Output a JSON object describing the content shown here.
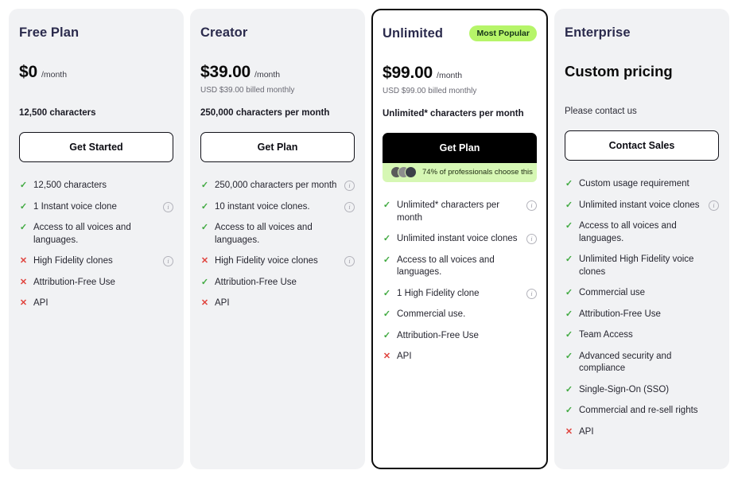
{
  "plans": [
    {
      "name": "Free Plan",
      "badge": null,
      "price": "$0",
      "per": "/month",
      "billed": "",
      "chars": "12,500 characters",
      "chars_bold": true,
      "cta": "Get Started",
      "cta_style": "outline",
      "promo": null,
      "features": [
        {
          "ok": true,
          "text": "12,500 characters",
          "info": false
        },
        {
          "ok": true,
          "text": "1 Instant voice clone",
          "info": true
        },
        {
          "ok": true,
          "text": "Access to all voices and languages.",
          "info": false
        },
        {
          "ok": false,
          "text": "High Fidelity clones",
          "info": true
        },
        {
          "ok": false,
          "text": "Attribution-Free Use",
          "info": false
        },
        {
          "ok": false,
          "text": "API",
          "info": false
        }
      ]
    },
    {
      "name": "Creator",
      "badge": null,
      "price": "$39.00",
      "per": "/month",
      "billed": "USD $39.00 billed monthly",
      "chars": "250,000 characters per month",
      "chars_bold": true,
      "cta": "Get Plan",
      "cta_style": "outline",
      "promo": null,
      "features": [
        {
          "ok": true,
          "text": "250,000 characters per month",
          "info": true
        },
        {
          "ok": true,
          "text": "10 instant voice clones.",
          "info": true
        },
        {
          "ok": true,
          "text": "Access to all voices and languages.",
          "info": false
        },
        {
          "ok": false,
          "text": "High Fidelity voice clones",
          "info": true
        },
        {
          "ok": true,
          "text": "Attribution-Free Use",
          "info": false
        },
        {
          "ok": false,
          "text": "API",
          "info": false
        }
      ]
    },
    {
      "name": "Unlimited",
      "badge": "Most Popular",
      "price": "$99.00",
      "per": "/month",
      "billed": "USD $99.00 billed monthly",
      "chars": "Unlimited* characters per month",
      "chars_bold": true,
      "cta": "Get Plan",
      "cta_style": "dark",
      "promo": "74% of professionals choose this",
      "features": [
        {
          "ok": true,
          "text": "Unlimited* characters per month",
          "info": true
        },
        {
          "ok": true,
          "text": "Unlimited instant voice clones",
          "info": true
        },
        {
          "ok": true,
          "text": "Access to all voices and languages.",
          "info": false
        },
        {
          "ok": true,
          "text": "1 High Fidelity clone",
          "info": true
        },
        {
          "ok": true,
          "text": "Commercial use.",
          "info": false
        },
        {
          "ok": true,
          "text": "Attribution-Free Use",
          "info": false
        },
        {
          "ok": false,
          "text": "API",
          "info": false
        }
      ]
    },
    {
      "name": "Enterprise",
      "badge": null,
      "price": "Custom pricing",
      "per": "",
      "billed": "",
      "chars": "Please contact us",
      "chars_bold": false,
      "cta": "Contact Sales",
      "cta_style": "outline",
      "promo": null,
      "features": [
        {
          "ok": true,
          "text": "Custom usage requirement",
          "info": false
        },
        {
          "ok": true,
          "text": "Unlimited instant voice clones",
          "info": true
        },
        {
          "ok": true,
          "text": "Access to all voices and languages.",
          "info": false
        },
        {
          "ok": true,
          "text": "Unlimited High Fidelity voice clones",
          "info": false
        },
        {
          "ok": true,
          "text": "Commercial use",
          "info": false
        },
        {
          "ok": true,
          "text": "Attribution-Free Use",
          "info": false
        },
        {
          "ok": true,
          "text": "Team Access",
          "info": false
        },
        {
          "ok": true,
          "text": "Advanced security and compliance",
          "info": false
        },
        {
          "ok": true,
          "text": "Single-Sign-On (SSO)",
          "info": false
        },
        {
          "ok": true,
          "text": "Commercial and re-sell rights",
          "info": false
        },
        {
          "ok": false,
          "text": "API",
          "info": false
        }
      ]
    }
  ],
  "icons": {
    "check": "✓",
    "cross": "✕",
    "info": "i"
  },
  "colors": {
    "check": "#3fa93f",
    "cross": "#e0443e",
    "badge_bg": "#b6f569",
    "promo_bg": "#d6f7b4",
    "card_bg": "#f1f2f4",
    "featured_border": "#0c0c0c",
    "title": "#2b2b4d"
  }
}
